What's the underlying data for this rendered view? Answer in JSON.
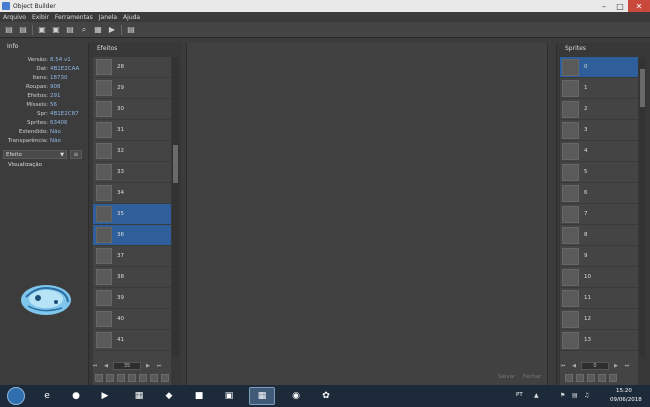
{
  "window": {
    "title": "Object Builder",
    "minimize": "–",
    "maximize": "□",
    "close": "✕"
  },
  "menu": [
    "Arquivo",
    "Exibir",
    "Ferramentas",
    "Janela",
    "Ajuda"
  ],
  "toolbar": {
    "icons": [
      "new-file-icon",
      "open-folder-icon",
      "compile-icon",
      "compile-as-icon",
      "import-icon",
      "search-icon",
      "animation-editor-icon",
      "play-icon",
      "sprite-editor-icon"
    ],
    "glyphs": [
      "▤",
      "▤",
      "▣",
      "▣",
      "▤",
      "⌕",
      "▦",
      "▶",
      "▤"
    ]
  },
  "info": {
    "title": "Info",
    "rows": [
      {
        "label": "Versão:",
        "value": "8.54 v1"
      },
      {
        "label": "Dat:",
        "value": "4B1E2CAA"
      },
      {
        "label": "Itens:",
        "value": "18730"
      },
      {
        "label": "Roupas:",
        "value": "908"
      },
      {
        "label": "Efeitos:",
        "value": "291"
      },
      {
        "label": "Mísseis:",
        "value": "56"
      },
      {
        "label": "Spr:",
        "value": "4B1E2C87"
      },
      {
        "label": "Sprites:",
        "value": "63406"
      },
      {
        "label": "Estendido:",
        "value": "Não"
      },
      {
        "label": "Transparência:",
        "value": "Não"
      }
    ]
  },
  "category": {
    "selected": "Efeito"
  },
  "preview": {
    "title": "Visualização"
  },
  "effects": {
    "title": "Efeitos",
    "items": [
      "28",
      "29",
      "30",
      "31",
      "32",
      "33",
      "34",
      "35",
      "36",
      "37",
      "38",
      "39",
      "40",
      "41"
    ],
    "selected": [
      "35",
      "36"
    ],
    "page_value": "35"
  },
  "actions": {
    "save": "Salvar",
    "close": "Fechar"
  },
  "sprites": {
    "title": "Sprites",
    "items": [
      "0",
      "1",
      "2",
      "3",
      "4",
      "5",
      "6",
      "7",
      "8",
      "9",
      "10",
      "11",
      "12",
      "13"
    ],
    "selected": [
      "0"
    ],
    "page_value": "0"
  },
  "taskbar": {
    "apps": [
      "ie-icon",
      "chrome-icon",
      "media-player-icon",
      "file-explorer-icon",
      "game-client-icon",
      "winrar-icon",
      "object-builder-icon",
      "app-icon",
      "red-app-icon",
      "flame-app-icon"
    ],
    "lang": "PT",
    "time": "15:20",
    "date": "09/06/2018"
  },
  "colors": {
    "accent": "#2f5f9a",
    "panel": "#383838",
    "info_value": "#8fb7e8"
  }
}
